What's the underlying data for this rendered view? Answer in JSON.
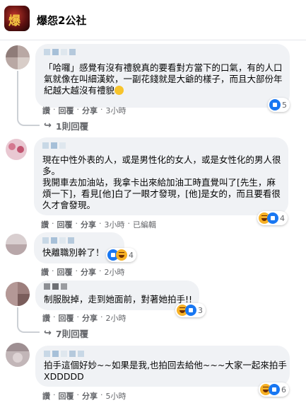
{
  "group": {
    "name": "爆怨2公社",
    "logo_text": "爆怨"
  },
  "actions": {
    "like": "讚",
    "reply": "回覆",
    "share": "分享",
    "dot": "·"
  },
  "colors": {
    "like": "#1877f2",
    "haha": "#f7b125",
    "bubble": "#f0f2f5",
    "meta": "#65676b"
  },
  "comments": [
    {
      "text": "「哈囉」感覺有沒有禮貌真的要看對方當下的口氣，有的人口氣就像在叫細漢欸，一副花錢就是大爺的樣子，而且大部份年紀越大越沒有禮貌",
      "reactions": [
        "like"
      ],
      "reaction_count": "5",
      "time": "3小時",
      "edited": "",
      "replies_label": "1則回覆"
    },
    {
      "text": "現在中性外表的人，或是男性化的女人，或是女性化的男人很多。\n我開車去加油站，我拿卡出來給加油工時直覺叫了[先生，麻煩一下]，看見[他]白了一眼才發現，[他]是女的，而且要看很久才會發現。",
      "reactions": [
        "haha",
        "like"
      ],
      "reaction_count": "4",
      "time": "3小時",
      "edited": "已編輯"
    },
    {
      "text": "快離職別幹了！",
      "reactions": [
        "like",
        "haha"
      ],
      "reaction_count": "4",
      "time": "2小時"
    },
    {
      "text": "制服脫掉，走到她面前，對著她拍手!!",
      "reactions": [
        "haha",
        "like"
      ],
      "reaction_count": "3",
      "time": "2小時",
      "replies_label": "7則回覆"
    },
    {
      "text": "拍手這個好妙~~如果是我,也拍回去給他~~~大家一起來拍手 XDDDDD",
      "reactions": [
        "haha",
        "like"
      ],
      "reaction_count": "6",
      "time": "5小時"
    }
  ]
}
